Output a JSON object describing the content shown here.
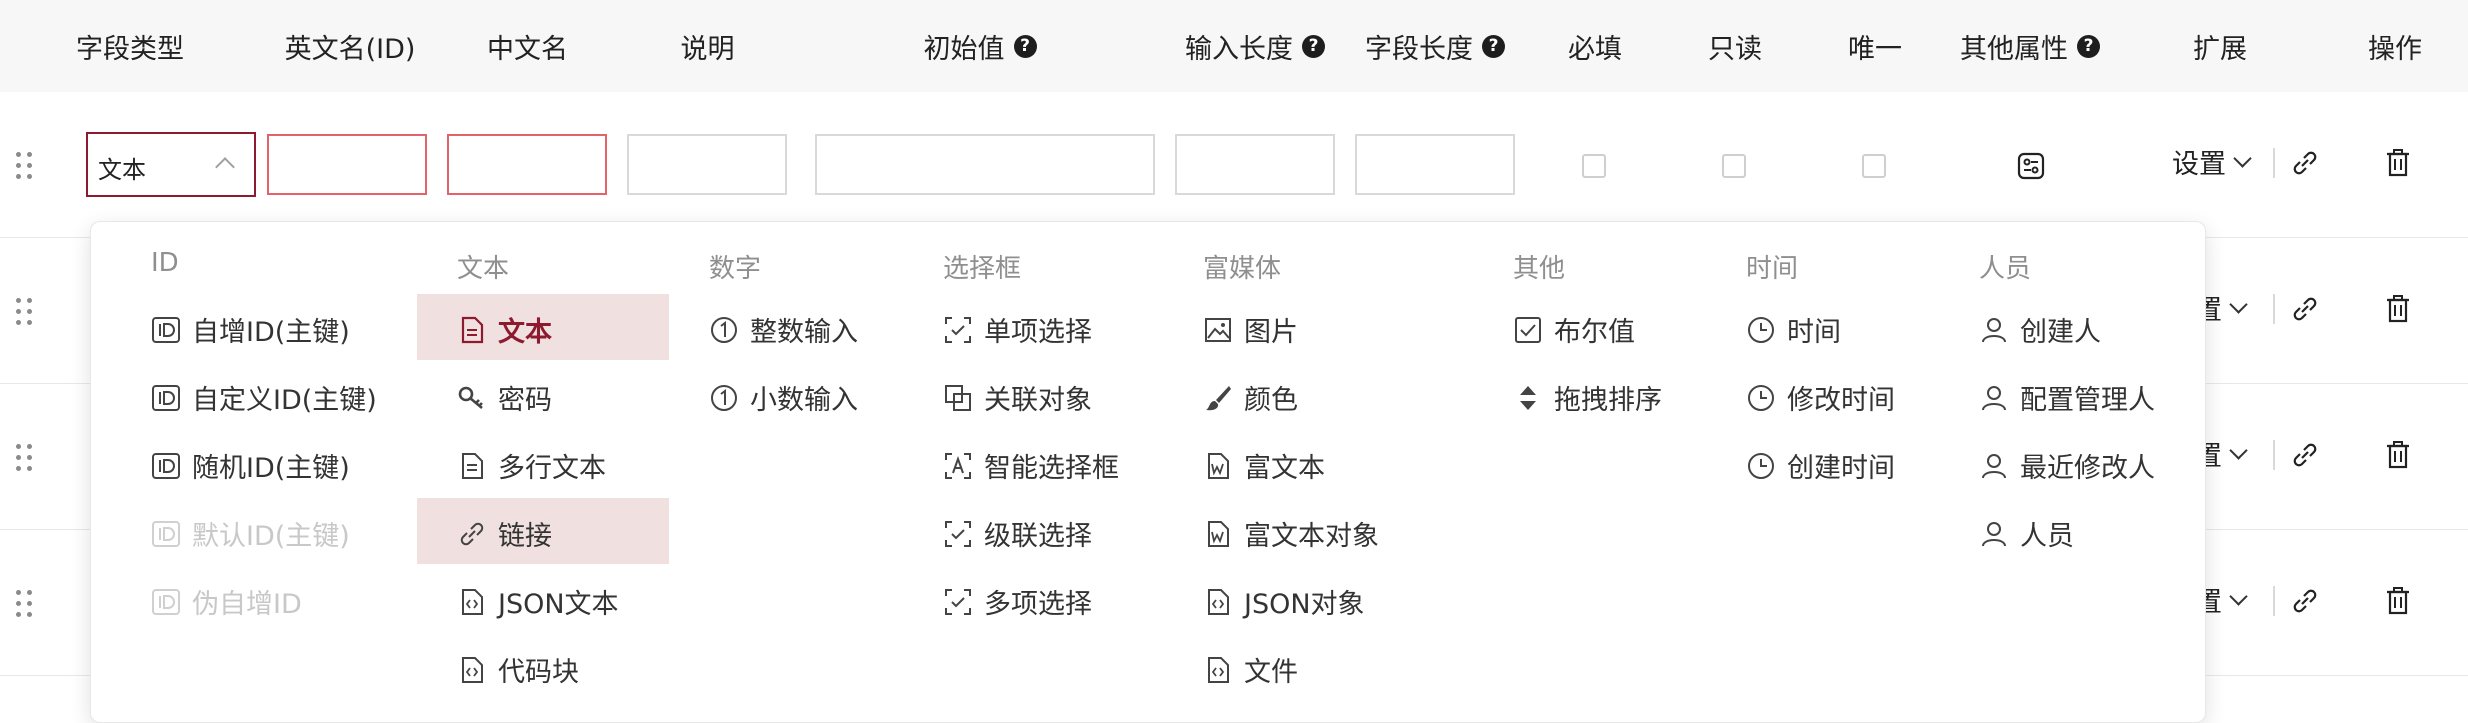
{
  "header": {
    "columns": [
      {
        "label": "字段类型"
      },
      {
        "label": "英文名(ID)"
      },
      {
        "label": "中文名"
      },
      {
        "label": "说明"
      },
      {
        "label": "初始值",
        "help": true
      },
      {
        "label": "输入长度",
        "help": true
      },
      {
        "label": "字段长度",
        "help": true
      },
      {
        "label": "必填"
      },
      {
        "label": "只读"
      },
      {
        "label": "唯一"
      },
      {
        "label": "其他属性",
        "help": true
      },
      {
        "label": "扩展"
      },
      {
        "label": "操作"
      }
    ],
    "help_glyph": "?"
  },
  "row": {
    "field_type_value": "文本",
    "extend_label": "设置",
    "extend_label_clipped": "置"
  },
  "dropdown": {
    "groups": [
      {
        "title": "ID",
        "items": [
          {
            "label": "自增ID(主键)",
            "icon": "id-icon"
          },
          {
            "label": "自定义ID(主键)",
            "icon": "id-icon"
          },
          {
            "label": "随机ID(主键)",
            "icon": "id-icon"
          },
          {
            "label": "默认ID(主键)",
            "icon": "id-icon",
            "disabled": true
          },
          {
            "label": "伪自增ID",
            "icon": "id-icon",
            "disabled": true
          }
        ]
      },
      {
        "title": "文本",
        "items": [
          {
            "label": "文本",
            "icon": "text-doc-icon",
            "selected": true
          },
          {
            "label": "密码",
            "icon": "key-icon"
          },
          {
            "label": "多行文本",
            "icon": "text-doc-icon"
          },
          {
            "label": "链接",
            "icon": "link-icon",
            "hovered": true
          },
          {
            "label": "JSON文本",
            "icon": "code-doc-icon"
          },
          {
            "label": "代码块",
            "icon": "code-doc-icon"
          }
        ]
      },
      {
        "title": "数字",
        "items": [
          {
            "label": "整数输入",
            "icon": "number-one-icon"
          },
          {
            "label": "小数输入",
            "icon": "number-one-icon"
          }
        ]
      },
      {
        "title": "选择框",
        "items": [
          {
            "label": "单项选择",
            "icon": "select-check-icon"
          },
          {
            "label": "关联对象",
            "icon": "relation-icon"
          },
          {
            "label": "智能选择框",
            "icon": "smart-select-icon"
          },
          {
            "label": "级联选择",
            "icon": "select-check-icon"
          },
          {
            "label": "多项选择",
            "icon": "select-check-icon"
          }
        ]
      },
      {
        "title": "富媒体",
        "items": [
          {
            "label": "图片",
            "icon": "image-icon"
          },
          {
            "label": "颜色",
            "icon": "brush-icon"
          },
          {
            "label": "富文本",
            "icon": "word-doc-icon"
          },
          {
            "label": "富文本对象",
            "icon": "word-doc-icon"
          },
          {
            "label": "JSON对象",
            "icon": "code-doc-icon"
          },
          {
            "label": "文件",
            "icon": "code-doc-icon"
          }
        ]
      },
      {
        "title": "其他",
        "items": [
          {
            "label": "布尔值",
            "icon": "checkbox-icon"
          },
          {
            "label": "拖拽排序",
            "icon": "sort-icon"
          }
        ]
      },
      {
        "title": "时间",
        "items": [
          {
            "label": "时间",
            "icon": "clock-icon"
          },
          {
            "label": "修改时间",
            "icon": "clock-icon"
          },
          {
            "label": "创建时间",
            "icon": "clock-icon"
          }
        ]
      },
      {
        "title": "人员",
        "items": [
          {
            "label": "创建人",
            "icon": "user-icon"
          },
          {
            "label": "配置管理人",
            "icon": "user-icon"
          },
          {
            "label": "最近修改人",
            "icon": "user-icon"
          },
          {
            "label": "人员",
            "icon": "user-icon"
          }
        ]
      }
    ]
  },
  "colors": {
    "accent": "#8c1b2f",
    "error_border": "#e4636b",
    "selected_bg": "#f0e0e0",
    "disabled_text": "#c8c8c8"
  }
}
